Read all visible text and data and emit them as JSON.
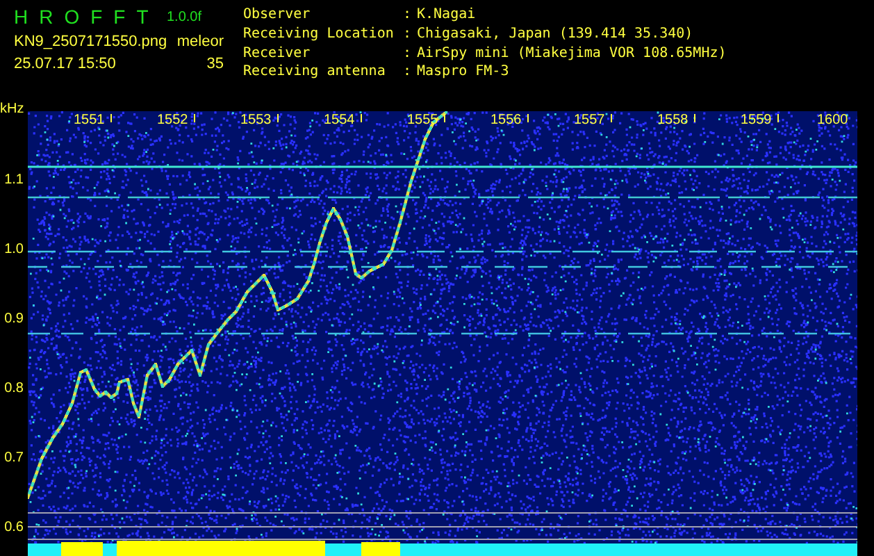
{
  "app": {
    "title": "HROFFT",
    "version": "1.0.0f"
  },
  "file": {
    "name": "KN9_2507171550.png",
    "timestamp": "25.07.17 15:50"
  },
  "meteor_count": {
    "label": "meleor",
    "value": "35"
  },
  "station": [
    {
      "label": "Observer",
      "sep": ":",
      "value": "K.Nagai"
    },
    {
      "label": "Receiving Location",
      "sep": ":",
      "value": "Chigasaki, Japan (139.414 35.340)"
    },
    {
      "label": "Receiver",
      "sep": ":",
      "value": "AirSpy mini (Miakejima VOR 108.65MHz)"
    },
    {
      "label": "Receiving antenna",
      "sep": ":",
      "value": "Maspro FM-3"
    }
  ],
  "spectrogram": {
    "unit": "kHz",
    "time_ticks": [
      "1551",
      "1552",
      "1553",
      "1554",
      "1555",
      "1556",
      "1557",
      "1558",
      "1559",
      "1600"
    ],
    "frequency_ticks": [
      "1.1",
      "1.0",
      "0.9",
      "0.8",
      "0.7",
      "0.6"
    ]
  }
}
